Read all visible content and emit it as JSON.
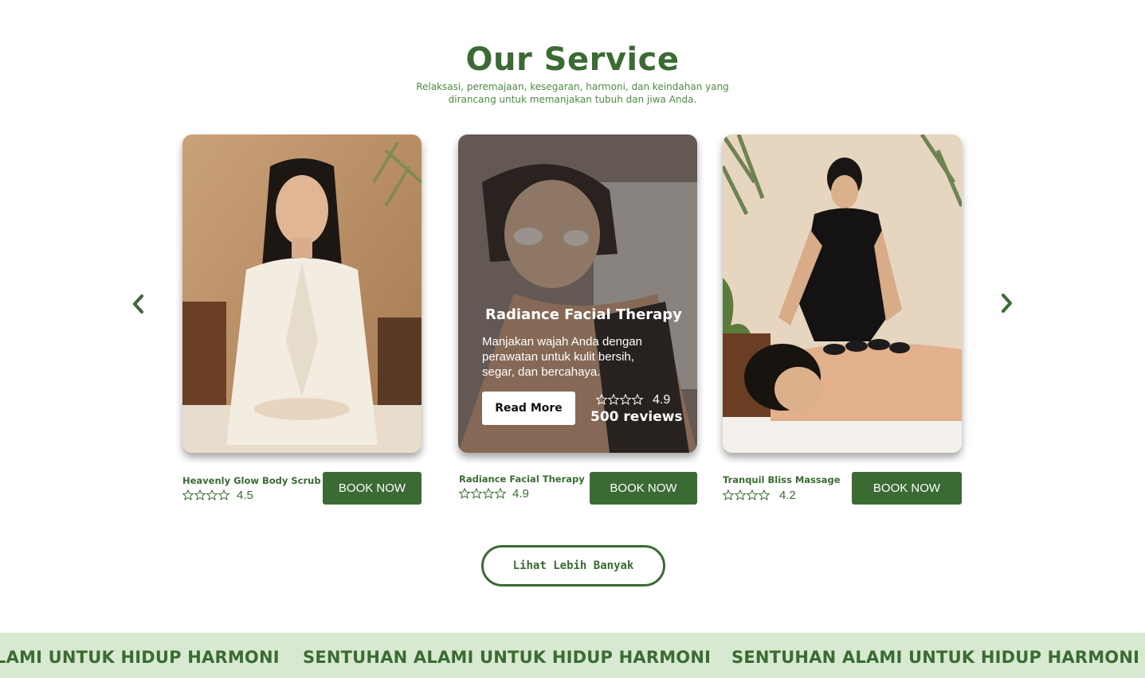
{
  "section": {
    "title": "Our Service",
    "subtitle": "Relaksasi, peremajaan, kesegaran, harmoni, dan keindahan yang dirancang untuk memanjakan tubuh dan jiwa Anda."
  },
  "carousel": {
    "prev_icon": "chevron-left-icon",
    "next_icon": "chevron-right-icon",
    "cards": [
      {
        "name": "Heavenly Glow Body Scrub",
        "rating": "4.5",
        "rating_value": 4.5,
        "book_label": "BOOK NOW"
      },
      {
        "name": "Radiance Facial Therapy",
        "rating": "4.9",
        "rating_value": 4.9,
        "book_label": "BOOK NOW",
        "overlay": {
          "title": "Radiance Facial Therapy",
          "description": "Manjakan wajah Anda dengan perawatan untuk kulit bersih, segar, dan bercahaya.",
          "read_more": "Read More",
          "rating": "4.9",
          "reviews": "500 reviews"
        }
      },
      {
        "name": "Tranquil Bliss Massage",
        "rating": "4.2",
        "rating_value": 4.2,
        "book_label": "BOOK NOW"
      }
    ]
  },
  "more_button": "Lihat Lebih Banyak",
  "marquee": {
    "text_partial": "LAMI UNTUK HIDUP HARMONI",
    "text": "SENTUHAN ALAMI UNTUK HIDUP HARMONI"
  },
  "colors": {
    "brand_green": "#3a6b33",
    "marquee_bg": "#d7ead1",
    "white": "#ffffff"
  }
}
